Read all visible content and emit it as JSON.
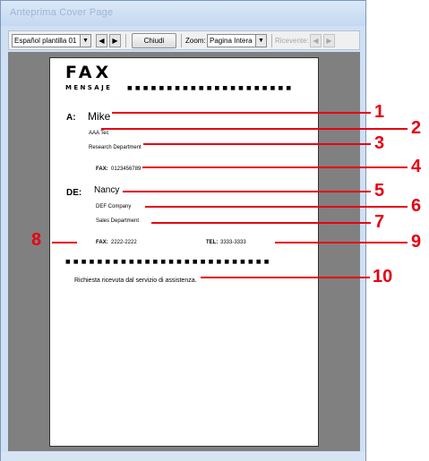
{
  "window": {
    "title": "Anteprima Cover Page"
  },
  "toolbar": {
    "template_select": "Español plantilla 01",
    "close_label": "Chiudi",
    "zoom_label": "Zoom:",
    "zoom_select": "Pagina Intera",
    "recipient_label": "Ricevente:",
    "prev_glyph": "◀",
    "next_glyph": "▶",
    "dropdown_glyph": "▼"
  },
  "page": {
    "fax_heading": "FAX",
    "mensaje": "MENSAJE",
    "dots_top": "■■■■■■■■■■■■■■■■■■■■■",
    "dots_bottom": "■■■■■■■■■■■■■■■■■■■■■■■■■■",
    "to_label": "A:",
    "to_name": "Mike",
    "to_company": "AAA Tec",
    "to_department": "Research Department",
    "to_fax_label": "FAX:",
    "to_fax": "0123456789",
    "from_label": "DE:",
    "from_name": "Nancy",
    "from_company": "DEF Company",
    "from_department": "Sales Department",
    "from_fax_label": "FAX:",
    "from_fax": "2222-2222",
    "tel_label": "TEL:",
    "tel": "3333-3333",
    "message": "Richiesta ricevuta dal servizio di assistenza."
  },
  "callouts": [
    "1",
    "2",
    "3",
    "4",
    "5",
    "6",
    "7",
    "8",
    "9",
    "10"
  ],
  "colors": {
    "callout": "#e60012",
    "viewer_bg": "#808080",
    "window_frame": "#cfe0f4"
  }
}
